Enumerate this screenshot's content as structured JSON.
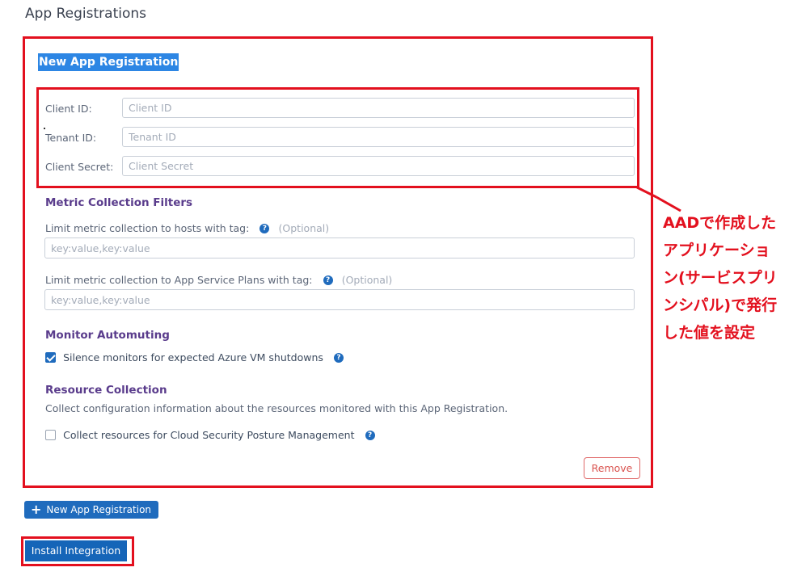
{
  "page_title": "App Registrations",
  "registration": {
    "title": "New App Registration",
    "credentials": {
      "client_id": {
        "label": "Client ID:",
        "placeholder": "Client ID",
        "value": ""
      },
      "tenant_id": {
        "label": "Tenant ID:",
        "placeholder": "Tenant ID",
        "value": ""
      },
      "client_secret": {
        "label": "Client Secret:",
        "placeholder": "Client Secret",
        "value": ""
      }
    },
    "metric_filters": {
      "title": "Metric Collection Filters",
      "hosts": {
        "label": "Limit metric collection to hosts with tag:",
        "optional": "(Optional)",
        "placeholder": "key:value,key:value",
        "value": ""
      },
      "app_service_plans": {
        "label": "Limit metric collection to App Service Plans with tag:",
        "optional": "(Optional)",
        "placeholder": "key:value,key:value",
        "value": ""
      }
    },
    "monitor_automuting": {
      "title": "Monitor Automuting",
      "silence_label": "Silence monitors for expected Azure VM shutdowns",
      "silence_checked": true
    },
    "resource_collection": {
      "title": "Resource Collection",
      "description": "Collect configuration information about the resources monitored with this App Registration.",
      "cspm_label": "Collect resources for Cloud Security Posture Management",
      "cspm_checked": false
    },
    "remove_label": "Remove"
  },
  "new_registration_label": "New App Registration",
  "install_label": "Install Integration",
  "annotation": {
    "lines": [
      "AADで作成した",
      "アプリケーショ",
      "ン(サービスプリ",
      "ンシパル)で発行",
      "した値を設定"
    ],
    "color": "#e3101e"
  },
  "icons": {
    "help": "question-circle-icon",
    "plus": "plus-icon",
    "check": "checkmark-icon"
  },
  "colors": {
    "primary_button": "#1f6bbd",
    "section_title": "#5a3c8c",
    "highlight_box": "#e3101e",
    "remove_button": "#d9534f"
  }
}
